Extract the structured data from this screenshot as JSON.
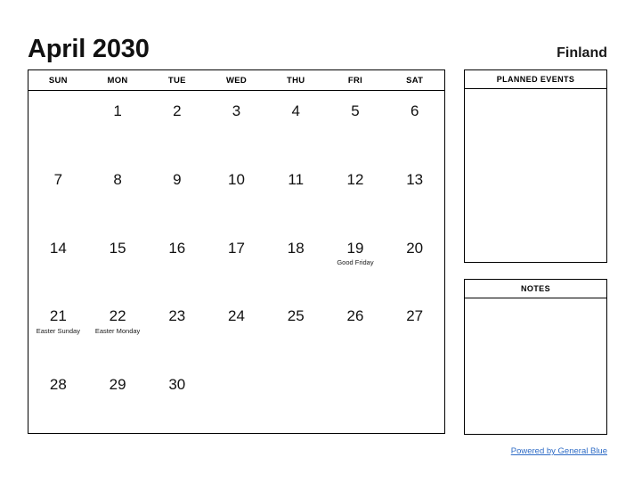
{
  "header": {
    "month_title": "April 2030",
    "country": "Finland"
  },
  "calendar": {
    "weekdays": [
      "SUN",
      "MON",
      "TUE",
      "WED",
      "THU",
      "FRI",
      "SAT"
    ],
    "weeks": [
      [
        {
          "day": "",
          "event": ""
        },
        {
          "day": "1",
          "event": ""
        },
        {
          "day": "2",
          "event": ""
        },
        {
          "day": "3",
          "event": ""
        },
        {
          "day": "4",
          "event": ""
        },
        {
          "day": "5",
          "event": ""
        },
        {
          "day": "6",
          "event": ""
        }
      ],
      [
        {
          "day": "7",
          "event": ""
        },
        {
          "day": "8",
          "event": ""
        },
        {
          "day": "9",
          "event": ""
        },
        {
          "day": "10",
          "event": ""
        },
        {
          "day": "11",
          "event": ""
        },
        {
          "day": "12",
          "event": ""
        },
        {
          "day": "13",
          "event": ""
        }
      ],
      [
        {
          "day": "14",
          "event": ""
        },
        {
          "day": "15",
          "event": ""
        },
        {
          "day": "16",
          "event": ""
        },
        {
          "day": "17",
          "event": ""
        },
        {
          "day": "18",
          "event": ""
        },
        {
          "day": "19",
          "event": "Good Friday"
        },
        {
          "day": "20",
          "event": ""
        }
      ],
      [
        {
          "day": "21",
          "event": "Easter Sunday"
        },
        {
          "day": "22",
          "event": "Easter Monday"
        },
        {
          "day": "23",
          "event": ""
        },
        {
          "day": "24",
          "event": ""
        },
        {
          "day": "25",
          "event": ""
        },
        {
          "day": "26",
          "event": ""
        },
        {
          "day": "27",
          "event": ""
        }
      ],
      [
        {
          "day": "28",
          "event": ""
        },
        {
          "day": "29",
          "event": ""
        },
        {
          "day": "30",
          "event": ""
        },
        {
          "day": "",
          "event": ""
        },
        {
          "day": "",
          "event": ""
        },
        {
          "day": "",
          "event": ""
        },
        {
          "day": "",
          "event": ""
        }
      ]
    ]
  },
  "panels": {
    "planned_events_title": "PLANNED EVENTS",
    "notes_title": "NOTES"
  },
  "footer": {
    "powered_by": "Powered by General Blue"
  },
  "colors": {
    "link": "#2f6cc6",
    "border": "#000000",
    "text": "#111111",
    "background": "#ffffff"
  }
}
